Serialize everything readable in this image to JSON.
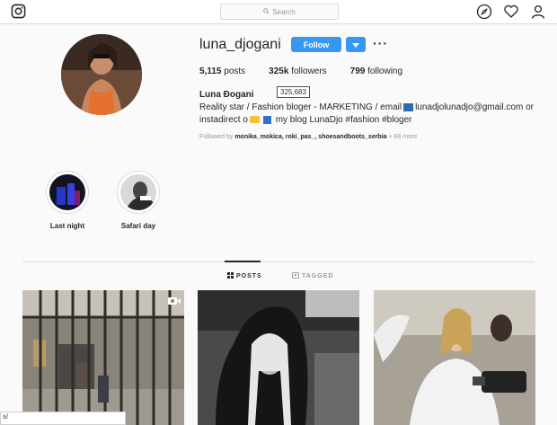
{
  "nav": {
    "search_placeholder": "Search",
    "icons": [
      "instagram-icon",
      "compass-icon",
      "heart-icon",
      "user-icon"
    ]
  },
  "profile": {
    "username": "luna_djogani",
    "follow_label": "Follow",
    "more_label": "···",
    "stats": {
      "posts_count": "5,115",
      "posts_label": "posts",
      "followers_count": "325k",
      "followers_label": "followers",
      "following_count": "799",
      "following_label": "following"
    },
    "followers_tooltip": "325,683",
    "full_name": "Luna Đogani",
    "bio_line1_a": "Reality star / Fashion bloger - MARKETING / email",
    "bio_line1_b": "lunadjolunadjo@gmail.com or",
    "bio_line2_a": "instadirect o",
    "bio_line2_b": "my blog LunaDjo #fashion #bloger",
    "followed_by_prefix": "Followed by",
    "followed_by_users": "monika_mokica, roki_pas_, shoesandboots_serbia",
    "followed_by_more": "+ 68 more"
  },
  "highlights": [
    {
      "label": "Last night"
    },
    {
      "label": "Safari day"
    }
  ],
  "tabs": {
    "posts_label": "POSTS",
    "tagged_label": "TAGGED"
  },
  "statusbar": {
    "text": "s/"
  },
  "colors": {
    "accent": "#3897f0",
    "background": "#fafafa",
    "border": "#dbdbdb"
  }
}
